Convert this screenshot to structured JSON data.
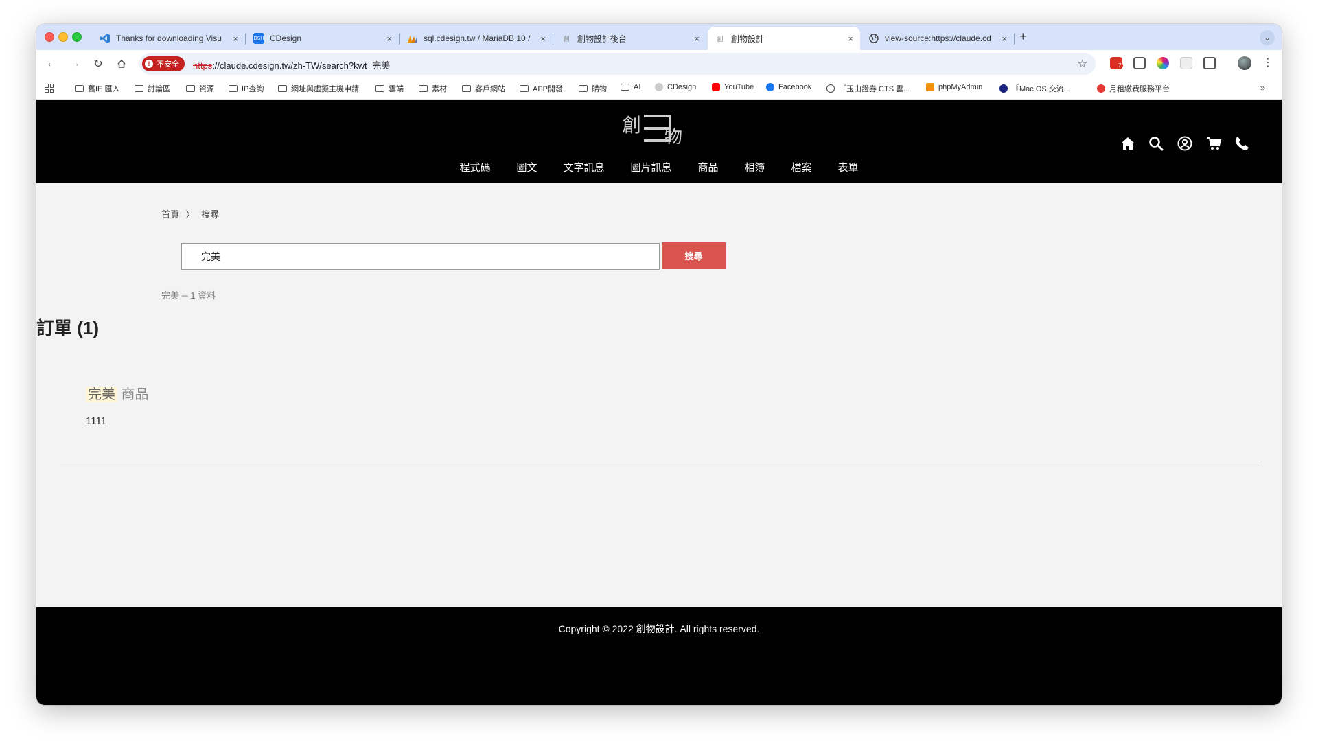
{
  "tabs": [
    {
      "title": "Thanks for downloading Visu",
      "icon": "vscode-icon"
    },
    {
      "title": "CDesign",
      "icon": "dsh-icon"
    },
    {
      "title": "sql.cdesign.tw / MariaDB 10 /",
      "icon": "phpmyadmin-icon"
    },
    {
      "title": "創物設計後台",
      "icon": "cdesign-icon"
    },
    {
      "title": "創物設計",
      "icon": "cdesign-icon"
    },
    {
      "title": "view-source:https://claude.cd",
      "icon": "globe-icon"
    }
  ],
  "tab_close": "×",
  "new_tab": "+",
  "address": {
    "security_label": "不安全",
    "scheme": "https",
    "rest": "://claude.cdesign.tw/zh-TW/search?kwt=完美"
  },
  "extension_badge": "7",
  "bookmarks": [
    {
      "label": "舊IE 匯入",
      "type": "folder"
    },
    {
      "label": "討論區",
      "type": "folder"
    },
    {
      "label": "資源",
      "type": "folder"
    },
    {
      "label": "IP查詢",
      "type": "folder"
    },
    {
      "label": "網址與虛擬主機申請",
      "type": "folder"
    },
    {
      "label": "雲端",
      "type": "folder"
    },
    {
      "label": "素材",
      "type": "folder"
    },
    {
      "label": "客戶網站",
      "type": "folder"
    },
    {
      "label": "APP開發",
      "type": "folder"
    },
    {
      "label": "購物",
      "type": "folder"
    },
    {
      "label": "AI",
      "type": "folder"
    },
    {
      "label": "CDesign",
      "type": "link"
    },
    {
      "label": "YouTube",
      "type": "link"
    },
    {
      "label": "Facebook",
      "type": "link"
    },
    {
      "label": "「玉山證券 CTS 雲...",
      "type": "link"
    },
    {
      "label": "phpMyAdmin",
      "type": "link"
    },
    {
      "label": "『Mac OS 交流...",
      "type": "link"
    },
    {
      "label": "月租繳費服務平台",
      "type": "link"
    }
  ],
  "site": {
    "logo_left": "創",
    "logo_right": "物",
    "nav": [
      "程式碼",
      "圖文",
      "文字訊息",
      "圖片訊息",
      "商品",
      "相簿",
      "檔案",
      "表單"
    ],
    "header_icons": [
      "home-icon",
      "search-icon",
      "user-icon",
      "cart-icon",
      "phone-icon"
    ]
  },
  "breadcrumb": {
    "home": "首頁",
    "separator": "〉",
    "current": "搜尋"
  },
  "search": {
    "value": "完美",
    "button": "搜尋"
  },
  "result_summary": "完美 ─ 1 資料",
  "section_title": "訂單 (1)",
  "result_item": {
    "highlight": "完美",
    "title_rest": " 商品",
    "body": "1111"
  },
  "footer": {
    "copyright": "Copyright © 2022 創物設計. All rights reserved."
  },
  "colors": {
    "accent": "#d9534f",
    "header_bg": "#000000",
    "tabstrip": "#d6e3fa",
    "insecure": "#c5221f"
  }
}
